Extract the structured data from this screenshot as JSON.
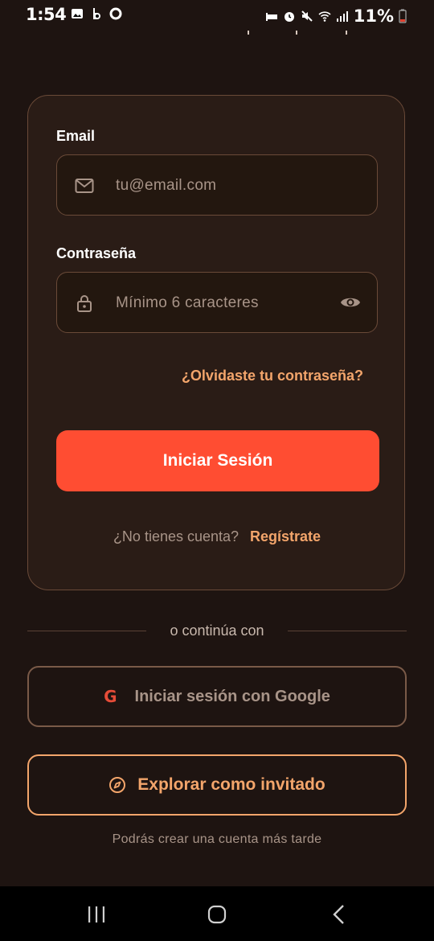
{
  "status_bar": {
    "time": "1:54",
    "left_icons": [
      "gallery-icon",
      "b-app-icon",
      "o-app-icon"
    ],
    "right_icons": [
      "sleep-icon",
      "alarm-icon",
      "mute-icon",
      "wifi-icon",
      "signal-icon"
    ],
    "battery": "11%"
  },
  "login_card": {
    "email_label": "Email",
    "email_placeholder": "tu@email.com",
    "password_label": "Contraseña",
    "password_placeholder": "Mínimo 6 caracteres",
    "forgot_link": "¿Olvidaste tu contraseña?",
    "submit_button": "Iniciar Sesión",
    "no_account_text": "¿No tienes cuenta?",
    "register_link": "Regístrate"
  },
  "divider_text": "o continúa con",
  "google_button": {
    "icon_letter": "G",
    "label": "Iniciar sesión con Google"
  },
  "guest_button": {
    "label": "Explorar como invitado"
  },
  "later_note": "Podrás crear una cuenta más tarde",
  "colors": {
    "background": "#1e1411",
    "card": "#2a1c16",
    "accent": "#ff4d32",
    "link": "#f3a56b"
  }
}
